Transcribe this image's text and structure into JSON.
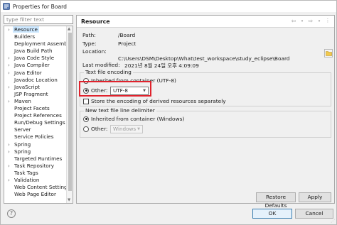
{
  "window": {
    "title": "Properties for Board"
  },
  "filter": {
    "placeholder": "type filter text"
  },
  "tree": {
    "items": [
      {
        "label": "Resource",
        "expandable": true,
        "selected": true
      },
      {
        "label": "Builders",
        "expandable": false
      },
      {
        "label": "Deployment Assembly",
        "expandable": false
      },
      {
        "label": "Java Build Path",
        "expandable": false
      },
      {
        "label": "Java Code Style",
        "expandable": true
      },
      {
        "label": "Java Compiler",
        "expandable": true
      },
      {
        "label": "Java Editor",
        "expandable": true
      },
      {
        "label": "Javadoc Location",
        "expandable": false
      },
      {
        "label": "JavaScript",
        "expandable": true
      },
      {
        "label": "JSP Fragment",
        "expandable": false
      },
      {
        "label": "Maven",
        "expandable": true
      },
      {
        "label": "Project Facets",
        "expandable": false
      },
      {
        "label": "Project References",
        "expandable": false
      },
      {
        "label": "Run/Debug Settings",
        "expandable": false
      },
      {
        "label": "Server",
        "expandable": false
      },
      {
        "label": "Service Policies",
        "expandable": false
      },
      {
        "label": "Spring",
        "expandable": true
      },
      {
        "label": "Spring",
        "expandable": true
      },
      {
        "label": "Targeted Runtimes",
        "expandable": false
      },
      {
        "label": "Task Repository",
        "expandable": true
      },
      {
        "label": "Task Tags",
        "expandable": false
      },
      {
        "label": "Validation",
        "expandable": true
      },
      {
        "label": "Web Content Settings",
        "expandable": false
      },
      {
        "label": "Web Page Editor",
        "expandable": false
      }
    ]
  },
  "resource": {
    "title": "Resource",
    "path_label": "Path:",
    "path_value": "/Board",
    "type_label": "Type:",
    "type_value": "Project",
    "location_label": "Location:",
    "location_value": "C:\\Users\\DSM\\Desktop\\What\\test_workspace\\study_eclipse\\Board",
    "modified_label": "Last modified:",
    "modified_value": "2021년 8월 24일 오후 4:09:09"
  },
  "encoding": {
    "legend": "Text file encoding",
    "inherited_label": "Inherited from container (UTF-8)",
    "other_label": "Other:",
    "other_value": "UTF-8",
    "store_label": "Store the encoding of derived resources separately"
  },
  "delimiter": {
    "legend": "New text file line delimiter",
    "inherited_label": "Inherited from container (Windows)",
    "other_label": "Other:",
    "other_value": "Windows"
  },
  "buttons": {
    "restore_defaults": "Restore Defaults",
    "apply": "Apply",
    "ok": "OK",
    "cancel": "Cancel"
  },
  "colors": {
    "highlight_border": "#e0222c",
    "selection": "#cde8ff",
    "primary_button_border": "#3c7fb1"
  },
  "icons": {
    "app": "eclipse-properties-icon",
    "location": "open-folder-icon",
    "help": "help-icon"
  }
}
